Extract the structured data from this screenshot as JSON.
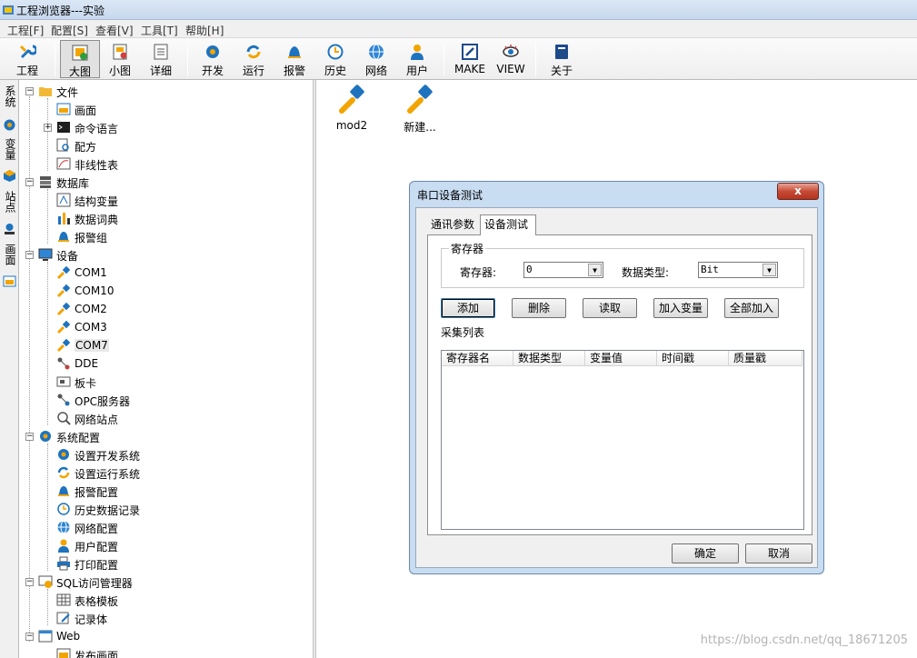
{
  "window": {
    "title": "工程浏览器---实验"
  },
  "menu": [
    "工程[F]",
    "配置[S]",
    "查看[V]",
    "工具[T]",
    "帮助[H]"
  ],
  "toolbar": {
    "buttons": [
      "工程",
      "大图",
      "小图",
      "详细",
      "开发",
      "运行",
      "报警",
      "历史",
      "网络",
      "用户",
      "MAKE",
      "VIEW",
      "关于"
    ]
  },
  "side_tabs": [
    "系统",
    "变量",
    "站点",
    "画面"
  ],
  "tree": {
    "file": "文件",
    "file_children": [
      "画面",
      "命令语言",
      "配方",
      "非线性表"
    ],
    "database": "数据库",
    "database_children": [
      "结构变量",
      "数据词典",
      "报警组"
    ],
    "device": "设备",
    "device_children": [
      "COM1",
      "COM10",
      "COM2",
      "COM3",
      "COM7",
      "DDE",
      "板卡",
      "OPC服务器",
      "网络站点"
    ],
    "sysconfig": "系统配置",
    "sysconfig_children": [
      "设置开发系统",
      "设置运行系统",
      "报警配置",
      "历史数据记录",
      "网络配置",
      "用户配置",
      "打印配置"
    ],
    "sql": "SQL访问管理器",
    "sql_children": [
      "表格模板",
      "记录体"
    ],
    "web": "Web",
    "web_children": [
      "发布画面"
    ]
  },
  "work_icons": [
    "mod2",
    "新建..."
  ],
  "dialog": {
    "title": "串口设备测试",
    "close": "x",
    "tabs": [
      "通讯参数",
      "设备测试"
    ],
    "group_title": "寄存器",
    "register_label": "寄存器:",
    "register_value": "0",
    "datatype_label": "数据类型:",
    "datatype_value": "Bit",
    "buttons": [
      "添加",
      "删除",
      "读取",
      "加入变量",
      "全部加入"
    ],
    "list_label": "采集列表",
    "columns": [
      "寄存器名",
      "数据类型",
      "变量值",
      "时间戳",
      "质量戳"
    ],
    "ok": "确定",
    "cancel": "取消"
  },
  "watermark": "https://blog.csdn.net/qq_18671205",
  "colors": {
    "accent_blue": "#1e73be",
    "accent_orange": "#f2a400"
  }
}
